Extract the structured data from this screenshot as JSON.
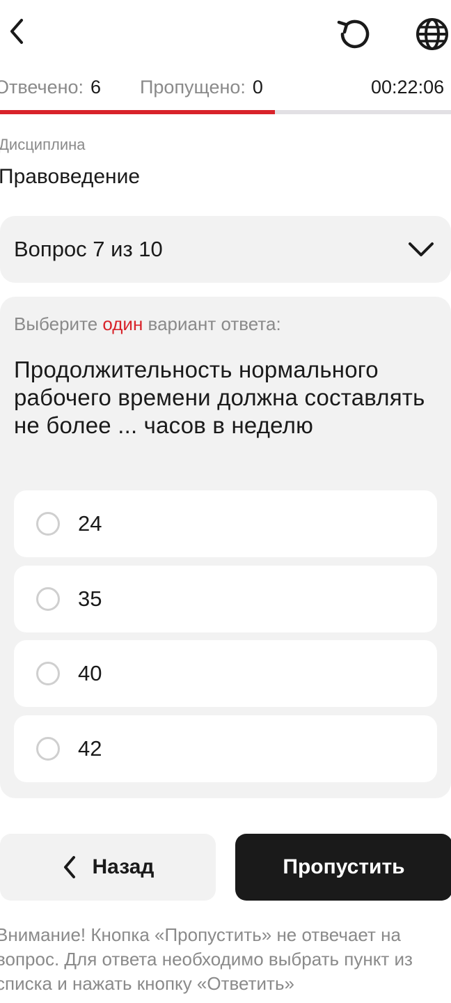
{
  "stats": {
    "answered_label": "Отвечено:",
    "answered_value": "6",
    "skipped_label": "Пропущено:",
    "skipped_value": "0",
    "timer": "00:22:06"
  },
  "progress": {
    "fraction": 0.61,
    "color": "#d8232a"
  },
  "discipline": {
    "label": "Дисциплина",
    "value": "Правоведение"
  },
  "question_selector": {
    "label": "Вопрос 7 из 10"
  },
  "question": {
    "instruction_prefix": "Выберите ",
    "instruction_accent": "один",
    "instruction_suffix": " вариант ответа:",
    "text": "Продолжительность нормального рабочего времени должна составлять не более ... часов в неделю",
    "options": [
      "24",
      "35",
      "40",
      "42"
    ]
  },
  "buttons": {
    "back": "Назад",
    "skip": "Пропустить"
  },
  "notice": "Внимание! Кнопка «Пропустить» не отвечает на вопрос. Для ответа необходимо выбрать пункт из списка и нажать кнопку «Ответить»",
  "icons": [
    "chevron-left-icon",
    "refresh-icon",
    "globe-icon",
    "chevron-down-icon",
    "radio-icon"
  ],
  "colors": {
    "accent": "#d8232a",
    "primary_button": "#1a1a1a",
    "card": "#f2f2f2"
  }
}
